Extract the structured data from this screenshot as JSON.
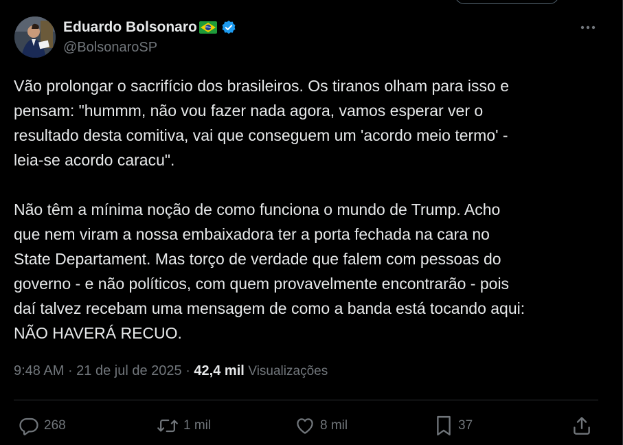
{
  "author": {
    "name": "Eduardo Bolsonaro",
    "handle": "@BolsonaroSP",
    "flag_icon": "brazil-flag-icon",
    "verified_icon": "verified-badge-icon"
  },
  "tweet": {
    "paragraph1": [
      "Vão prolongar o sacrifício dos brasileiros. Os tiranos olham para isso e",
      "pensam: \"hummm, não vou fazer nada agora, vamos esperar ver o",
      "resultado desta comitiva, vai que conseguem um 'acordo meio termo' -",
      "leia-se acordo caracu\"."
    ],
    "paragraph2": [
      "Não têm a mínima noção de como funciona o mundo de Trump. Acho",
      "que nem viram a nossa embaixadora ter a porta fechada na cara no",
      "State Departament. Mas torço de verdade que falem com pessoas do",
      "governo - e não políticos, com quem provavelmente encontrarão - pois",
      "daí talvez recebam uma mensagem de como a banda está tocando aqui:",
      "NÃO HAVERÁ RECUO."
    ]
  },
  "meta": {
    "time": "9:48 AM",
    "separator": " · ",
    "date": "21 de jul de 2025",
    "views_count": "42,4 mil",
    "views_label": "Visualizações"
  },
  "actions": {
    "replies": "268",
    "reposts": "1 mil",
    "likes": "8 mil",
    "bookmarks": "37"
  },
  "colors": {
    "background": "#000000",
    "text": "#e7e9ea",
    "secondary": "#71767b",
    "border": "#2f3336",
    "verified": "#1d9bf0"
  }
}
